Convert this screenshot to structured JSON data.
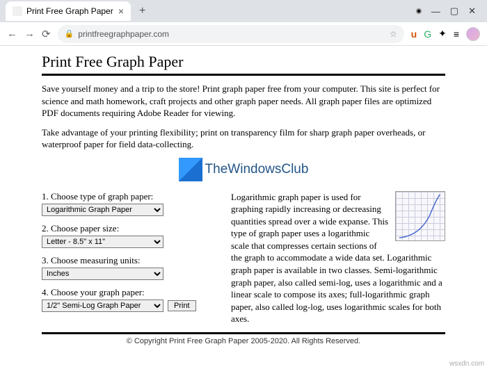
{
  "browser": {
    "tab_title": "Print Free Graph Paper",
    "url": "printfreegraphpaper.com"
  },
  "page": {
    "title": "Print Free Graph Paper",
    "intro1": "Save yourself money and a trip to the store! Print graph paper free from your computer. This site is perfect for science and math homework, craft projects and other graph paper needs. All graph paper files are optimized PDF documents requiring Adobe Reader for viewing.",
    "intro2": "Take advantage of your printing flexibility; print on transparency film for sharp graph paper overheads, or waterproof paper for field data-collecting.",
    "logo_text": "TheWindowsClub",
    "form": {
      "q1": "1. Choose type of graph paper:",
      "q1_val": "Logarithmic Graph Paper",
      "q2": "2. Choose paper size:",
      "q2_val": "Letter - 8.5\" x 11\"",
      "q3": "3. Choose measuring units:",
      "q3_val": "Inches",
      "q4": "4. Choose your graph paper:",
      "q4_val": "1/2\" Semi-Log Graph Paper",
      "print": "Print"
    },
    "desc": "Logarithmic graph paper is used for graphing rapidly increasing or decreasing quantities spread over a wide expanse. This type of graph paper uses a logarithmic scale that compresses certain sections of the graph to accommodate a wide data set. Logarithmic graph paper is available in two classes. Semi-logarithmic graph paper, also called semi-log, uses a logarithmic and a linear scale to compose its axes; full-logarithmic graph paper, also called log-log, uses logarithmic scales for both axes.",
    "footer": "© Copyright Print Free Graph Paper 2005-2020. All Rights Reserved."
  },
  "watermark": "wsxdn.com"
}
